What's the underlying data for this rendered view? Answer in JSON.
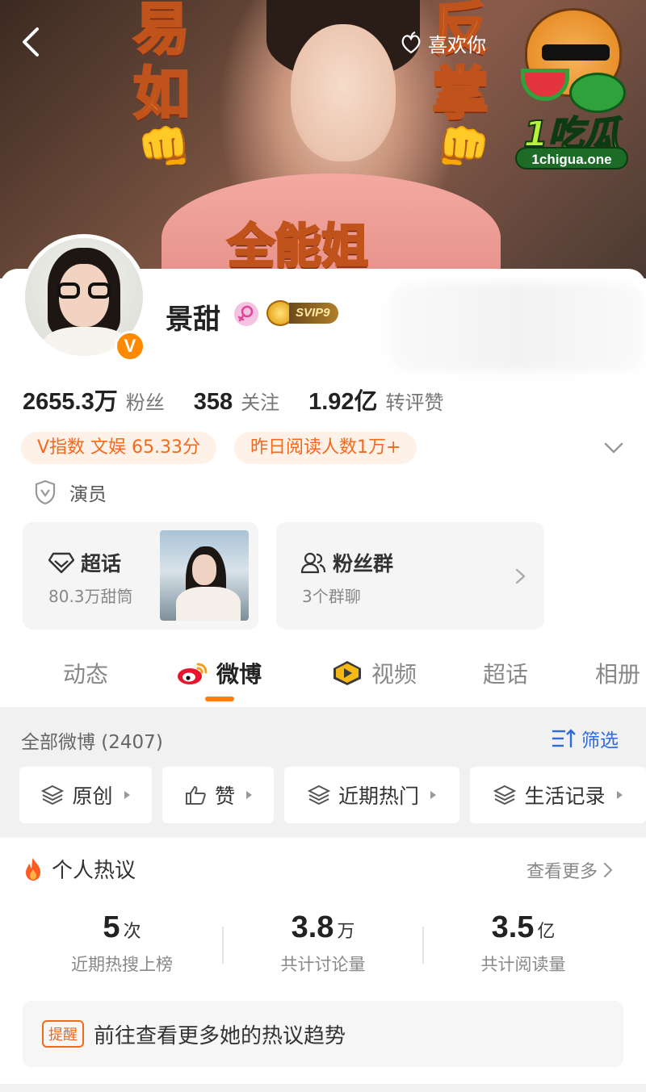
{
  "banner": {
    "text_left_top": "易",
    "text_left_mid": "如",
    "text_right_top": "反",
    "text_right_mid": "掌",
    "text_bottom": "全能姐",
    "like_label": "喜欢你"
  },
  "watermark": {
    "brand": "1吃瓜",
    "url": "1chigua.one"
  },
  "profile": {
    "name": "景甜",
    "vip_label": "SVIP9",
    "verified_badge": "V",
    "stats": [
      {
        "value": "2655.3万",
        "label": "粉丝"
      },
      {
        "value": "358",
        "label": "关注"
      },
      {
        "value": "1.92亿",
        "label": "转评赞"
      }
    ],
    "tags": [
      "V指数 文娱 65.33分",
      "昨日阅读人数1万+"
    ],
    "role": "演员"
  },
  "cards": {
    "super_topic": {
      "title": "超话",
      "sub": "80.3万甜筒"
    },
    "fan_group": {
      "title": "粉丝群",
      "sub": "3个群聊"
    }
  },
  "tabs": [
    {
      "label": "动态",
      "icon": "none"
    },
    {
      "label": "微博",
      "icon": "weibo-icon"
    },
    {
      "label": "视频",
      "icon": "video-icon"
    },
    {
      "label": "超话",
      "icon": "none"
    },
    {
      "label": "相册",
      "icon": "none"
    }
  ],
  "active_tab": "微博",
  "feed_filter": {
    "all_label": "全部微博 (2407)",
    "filter_label": "筛选",
    "chips": [
      "原创",
      "赞",
      "近期热门",
      "生活记录"
    ]
  },
  "hot_discussion": {
    "title": "个人热议",
    "more_label": "查看更多",
    "metrics": [
      {
        "value": "5",
        "unit": "次",
        "label": "近期热搜上榜"
      },
      {
        "value": "3.8",
        "unit": "万",
        "label": "共计讨论量"
      },
      {
        "value": "3.5",
        "unit": "亿",
        "label": "共计阅读量"
      }
    ],
    "reminder_badge": "提醒",
    "reminder_text": "前往查看更多她的热议趋势"
  },
  "colors": {
    "accent_orange": "#f36a1b",
    "tab_underline": "#ff7a1a",
    "link_blue": "#2d6be0",
    "tag_bg": "#fdf1e8"
  }
}
